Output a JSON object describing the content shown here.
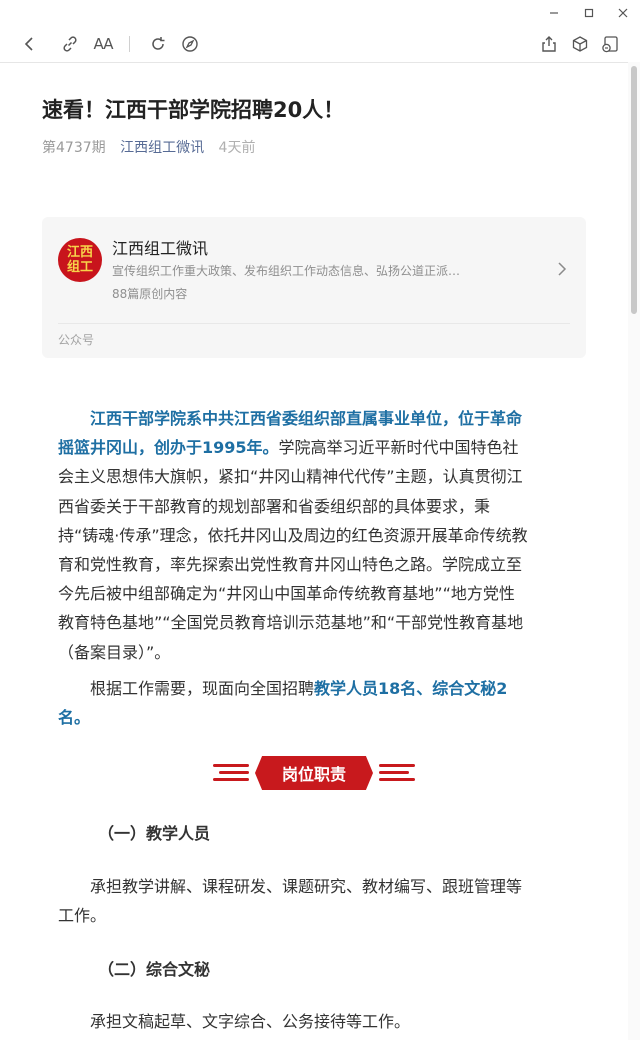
{
  "toolbar": {
    "icons": [
      "back-icon",
      "link-icon",
      "font-size-icon",
      "refresh-icon",
      "compass-icon",
      "share-icon",
      "cube-icon",
      "pip-icon"
    ],
    "font_icon_text": "AA"
  },
  "article": {
    "title": "速看！江西干部学院招聘20人！",
    "issue": "第4737期",
    "source": "江西组工微讯",
    "time": "4天前"
  },
  "account_card": {
    "avatar_line1": "江西",
    "avatar_line2": "组工",
    "name": "江西组工微讯",
    "description": "宣传组织工作重大政策、发布组织工作动态信息、弘扬公道正派…",
    "count": "88篇原创内容",
    "tag": "公众号"
  },
  "para1": {
    "l1": "江西干部学院系中共江西省委组织部直属事业单位，位于革命",
    "l2_hl": "摇篮井冈山，创办于1995年。",
    "l2_rest": "学院高举习近平新时代中国特色社",
    "l3": "会主义思想伟大旗帜，紧扣“井冈山精神代代传”主题，认真贯彻江",
    "l4": "西省委关于干部教育的规划部署和省委组织部的具体要求，秉",
    "l5": "持“铸魂·传承”理念，依托井冈山及周边的红色资源开展革命传统教",
    "l6": "育和党性教育，率先探索出党性教育井冈山特色之路。学院成立至",
    "l7": "今先后被中组部确定为“井冈山中国革命传统教育基地”“地方党性",
    "l8": "教育特色基地”“全国党员教育培训示范基地”和“干部党性教育基地",
    "l9": "（备案目录）”。"
  },
  "para2": {
    "l1_plain": "根据工作需要，现面向全国招聘",
    "l1_hl": "教学人员18名、综合文秘2",
    "l2_hl": "名。"
  },
  "banner": {
    "label": "岗位职责"
  },
  "section1": {
    "heading": "（一）教学人员",
    "l1": "承担教学讲解、课程研发、课题研究、教材编写、跟班管理等",
    "l2": "工作。"
  },
  "section2": {
    "heading": "（二）综合文秘",
    "l1": "承担文稿起草、文字综合、公务接待等工作。"
  },
  "colors": {
    "highlight": "#1e6fa3",
    "banner_red": "#c8191d",
    "source_link": "#576b95"
  }
}
